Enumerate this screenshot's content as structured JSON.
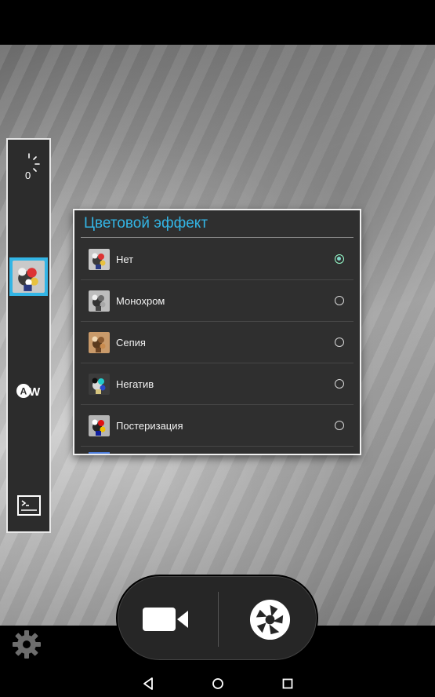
{
  "dialog": {
    "title": "Цветовой эффект",
    "options": [
      {
        "label": "Нет",
        "selected": true,
        "thumb_style": "color"
      },
      {
        "label": "Монохром",
        "selected": false,
        "thumb_style": "mono"
      },
      {
        "label": "Сепия",
        "selected": false,
        "thumb_style": "sepia"
      },
      {
        "label": "Негатив",
        "selected": false,
        "thumb_style": "negative"
      },
      {
        "label": "Постеризация",
        "selected": false,
        "thumb_style": "posterize"
      }
    ]
  },
  "side_panel": {
    "exposure_value": "0",
    "exposure_icon": "exposure-icon",
    "color_effect_icon": "color-effect-thumb-icon",
    "white_balance_icon": "auto-white-balance-icon",
    "scene_mode_icon": "scene-mode-icon"
  },
  "capture": {
    "video_icon": "video-camera-icon",
    "shutter_icon": "shutter-icon"
  },
  "settings_icon": "gear-icon",
  "nav": {
    "back_icon": "back-icon",
    "home_icon": "home-icon",
    "recents_icon": "recents-icon"
  },
  "colors": {
    "accent": "#33b5e5",
    "dialog_bg": "#2f2f2f",
    "radio_checked": "#7fd6c7"
  }
}
